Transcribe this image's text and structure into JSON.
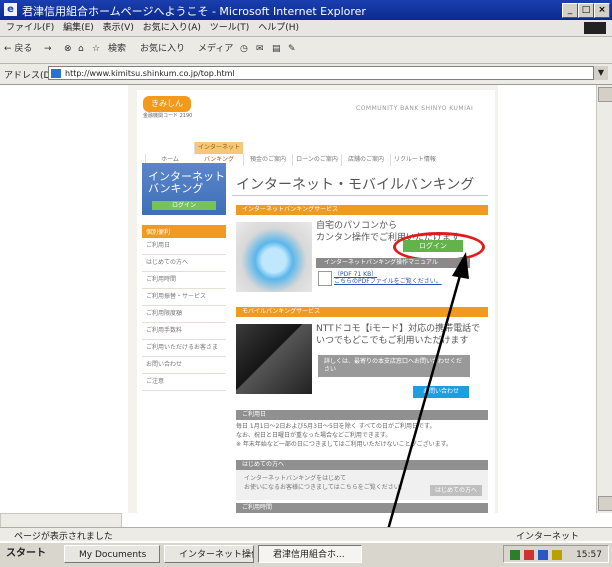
{
  "window": {
    "title": "君津信用組合ホームページへようこそ - Microsoft Internet Explorer",
    "controls": [
      "_",
      "□",
      "×"
    ]
  },
  "menu": [
    "ファイル(F)",
    "編集(E)",
    "表示(V)",
    "お気に入り(A)",
    "ツール(T)",
    "ヘルプ(H)"
  ],
  "toolbar": {
    "back": "← 戻る",
    "forward": "→",
    "buttons": [
      "⊗",
      "⌂",
      "☆",
      "検索",
      "お気に入り",
      "メディア",
      "◷",
      "✉",
      "▤",
      "✎"
    ]
  },
  "address": {
    "label": "アドレス(D)",
    "url": "http://www.kimitsu.shinkum.co.jp/top.html"
  },
  "site": {
    "logo": "きみしん",
    "logo_sub": "金融機関コード 2190",
    "tagline": "COMMUNITY BANK SHINYO KUMIAI",
    "nav": [
      "ホーム",
      "インターネットバンキング",
      "預金のご案内",
      "ローンのご案内",
      "店舗のご案内",
      "リクルート情報"
    ],
    "sidebar": {
      "title": "インターネット バンキング",
      "login": "ログイン",
      "header": "個別便利",
      "items": [
        "ご利用日",
        "はじめての方へ",
        "ご利用時間",
        "ご利用振替・サービス",
        "ご利用限度額",
        "ご利用手数料",
        "ご利用いただけるお客さま",
        "お問い合わせ",
        "ご注意"
      ]
    },
    "heading": "インターネット・モバイルバンキング",
    "ib_section": "インターネットバンキングサービス",
    "ib_text1": "自宅のパソコンから",
    "ib_text2": "カンタン操作でご利用いただけます",
    "login_button": "ログイン",
    "ib_bar": "インターネットバンキング操作マニュアル",
    "pdf_line1": "（PDF 71 KB）",
    "pdf_line2": "こちらのPDFファイルをご覧ください。",
    "mb_section": "モバイルバンキングサービス",
    "mb_text1": "NTTドコモ【iモード】対応の携帯電話で",
    "mb_text2": "いつでもどこでもご利用いただけます",
    "mb_box": "詳しくは、最寄りの本支店窓口へお問い合わせください",
    "inquiry_button": "お問い合わせ",
    "notice_title": "ご利用日",
    "notice1": "毎日 1月1日～2日および5月3日～5日を除く すべての日がご利用日です。",
    "notice2": "なお、祝日と日曜日が重なった場合などご利用できます。",
    "notice3": "※ 年末年始など一部の日につきましてはご利用いただけないことがございます。",
    "first_title": "はじめての方へ",
    "first_text1": "インターネットバンキングをはじめて",
    "first_text2": "お使いになるお客様につきましてはこちらをご覧ください。",
    "first_btn": "はじめての方へ",
    "time_title": "ご利用時間"
  },
  "status": {
    "text": "ページが表示されました",
    "zone": "インターネット"
  },
  "taskbar": {
    "start": "スタート",
    "tasks": [
      "My Documents",
      "インターネット操作",
      "君津信用組合ホ..."
    ],
    "clock": "15:57"
  }
}
